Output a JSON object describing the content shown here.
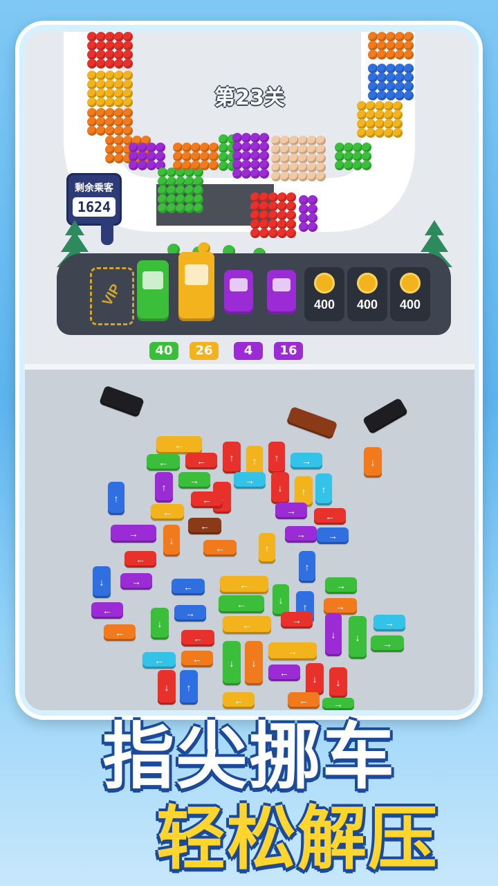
{
  "level": {
    "title": "第23关"
  },
  "passengers": {
    "label": "剩余乘客",
    "value": "1624"
  },
  "parking": {
    "vip_label": "VIP",
    "slots": [
      {
        "type": "vip"
      },
      {
        "type": "bus",
        "color": "#3bbf3b"
      },
      {
        "type": "bus",
        "color": "#f2b31c"
      },
      {
        "type": "bus",
        "color": "#9b2bd4"
      },
      {
        "type": "bus",
        "color": "#9b2bd4"
      },
      {
        "type": "locked",
        "price": "400"
      },
      {
        "type": "locked",
        "price": "400"
      },
      {
        "type": "locked",
        "price": "400"
      }
    ],
    "capacities": [
      {
        "value": "40",
        "color": "#3bbf3b"
      },
      {
        "value": "26",
        "color": "#f2b31c"
      },
      {
        "value": "4",
        "color": "#9b2bd4"
      },
      {
        "value": "16",
        "color": "#9b2bd4"
      }
    ]
  },
  "headline": {
    "line1": "指尖挪车",
    "line2": "轻松解压"
  },
  "colors": {
    "red": "#e8312b",
    "orange": "#f07a1c",
    "yellow": "#f2b31c",
    "green": "#3bbf3b",
    "blue": "#2f6fe0",
    "cyan": "#34c3e8",
    "purple": "#9b2bd4",
    "brown": "#8a3a16",
    "black": "#1e1e22",
    "peach": "#f1c9a4"
  }
}
